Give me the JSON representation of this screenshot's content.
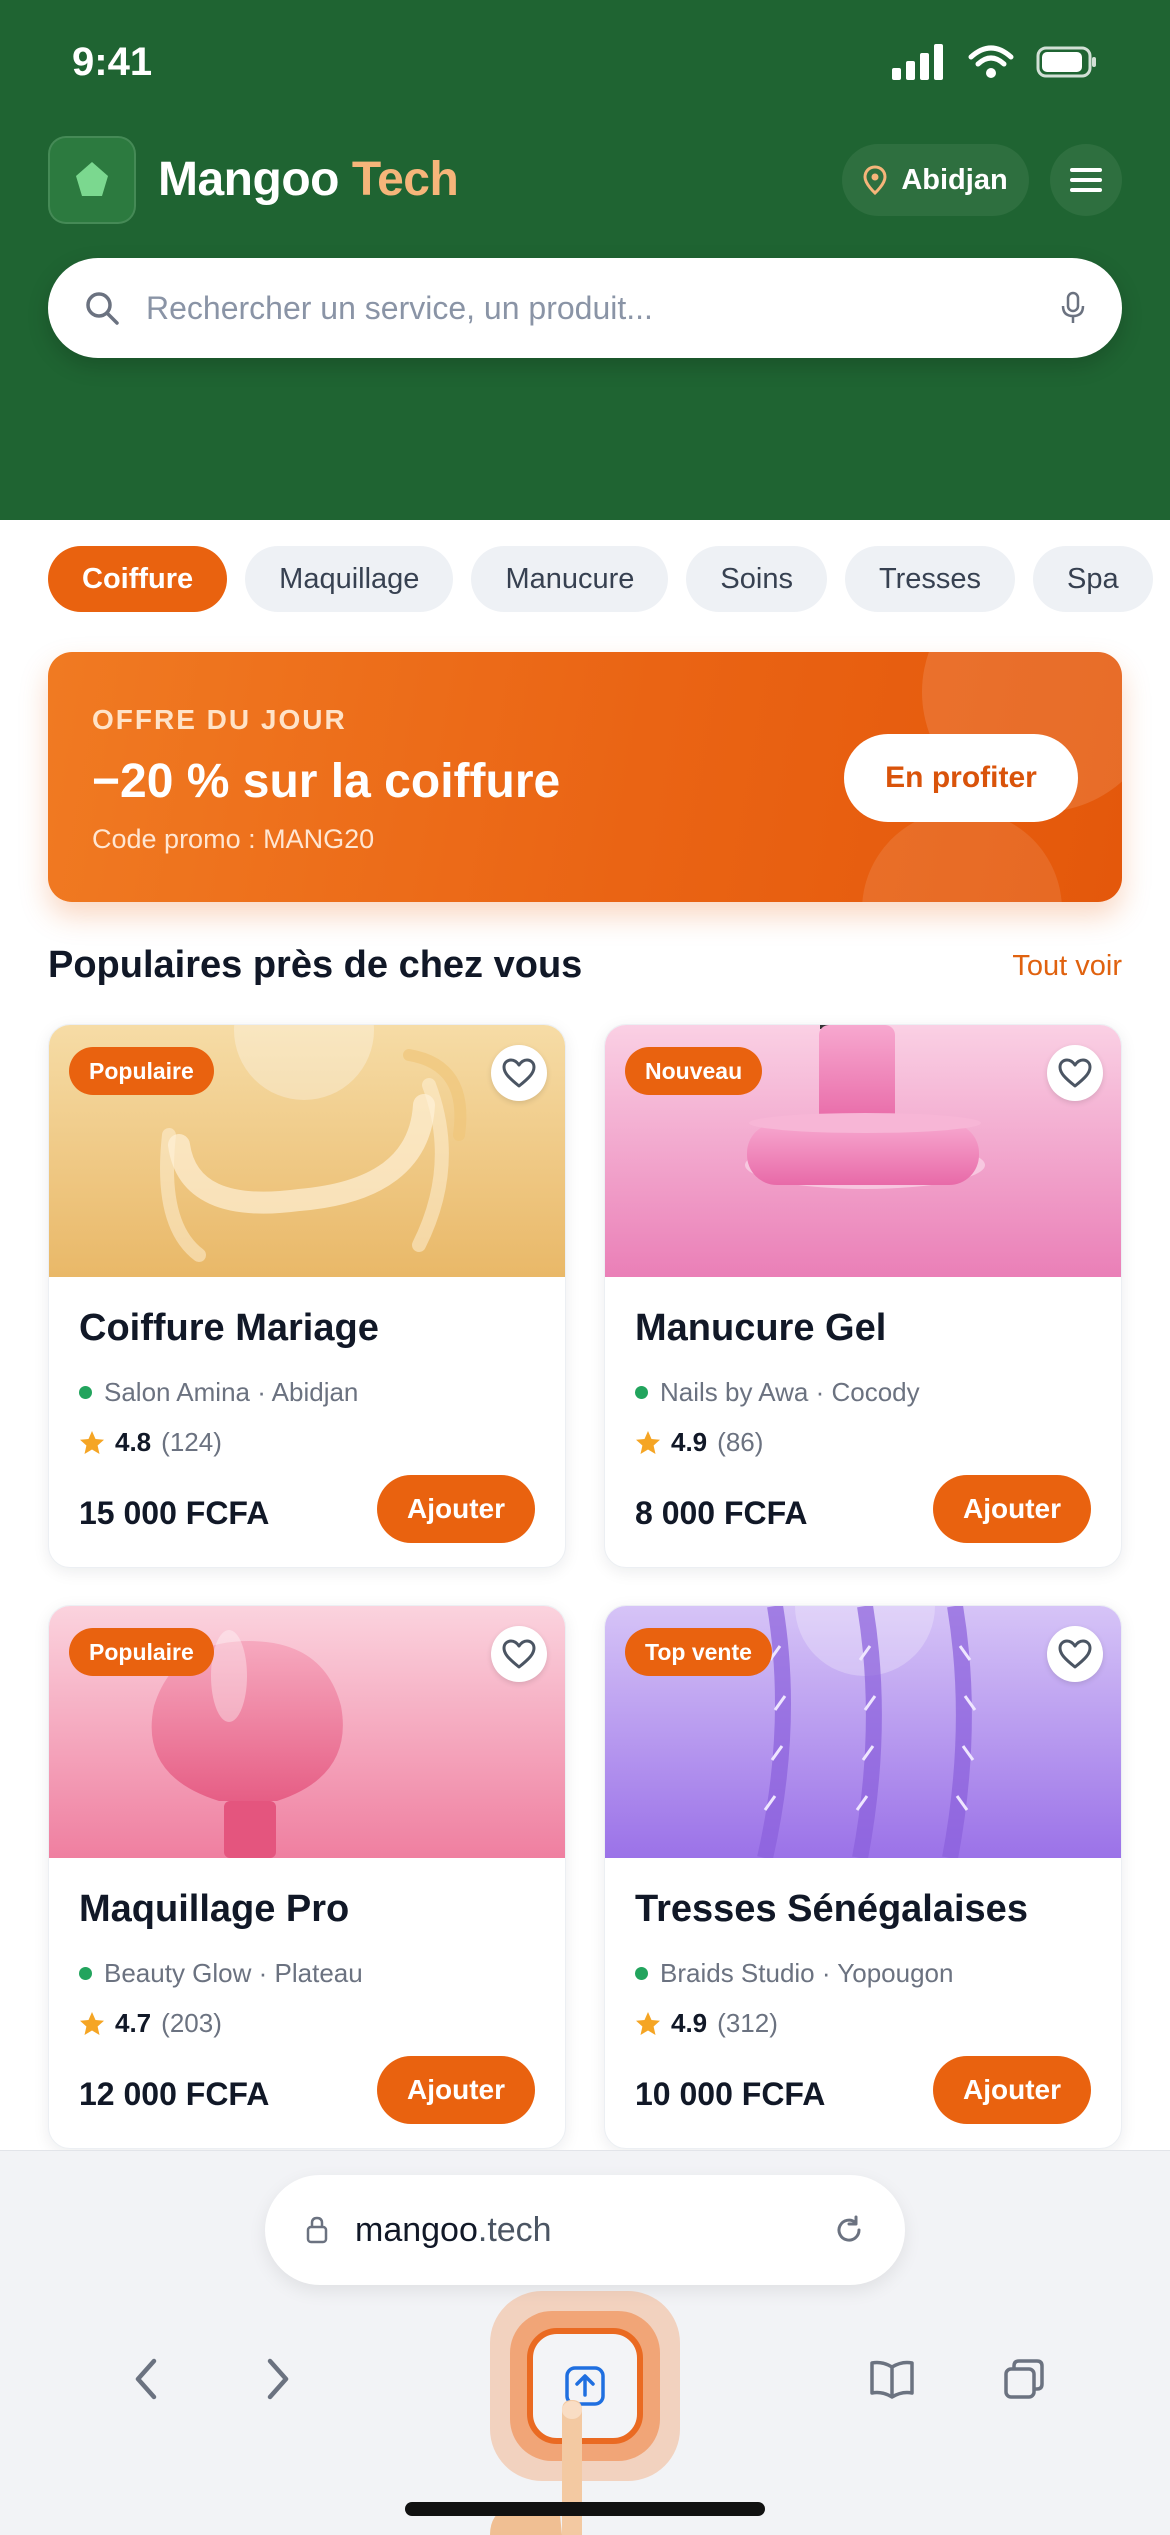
{
  "status_bar": {
    "time": "9:41"
  },
  "header": {
    "brand_main": "Mangoo",
    "brand_accent": "Tech",
    "location": "Abidjan"
  },
  "search": {
    "placeholder": "Rechercher un service, un produit..."
  },
  "categories": [
    {
      "label": "Coiffure",
      "active": true
    },
    {
      "label": "Maquillage",
      "active": false
    },
    {
      "label": "Manucure",
      "active": false
    },
    {
      "label": "Soins",
      "active": false
    },
    {
      "label": "Tresses",
      "active": false
    },
    {
      "label": "Spa",
      "active": false
    }
  ],
  "promo": {
    "kicker": "OFFRE DU JOUR",
    "title": "−20 % sur la coiffure",
    "code": "Code promo : MANG20",
    "button": "En profiter"
  },
  "section": {
    "title": "Populaires près de chez vous",
    "see_all": "Tout voir"
  },
  "products": [
    {
      "badge": "Populaire",
      "title": "Coiffure Mariage",
      "vendor": "Salon Amina · Abidjan",
      "rating": "4.8",
      "reviews": "(124)",
      "price": "15 000 FCFA",
      "button": "Ajouter"
    },
    {
      "badge": "Nouveau",
      "title": "Manucure Gel",
      "vendor": "Nails by Awa · Cocody",
      "rating": "4.9",
      "reviews": "(86)",
      "price": "8 000 FCFA",
      "button": "Ajouter"
    },
    {
      "badge": "Populaire",
      "title": "Maquillage Pro",
      "vendor": "Beauty Glow · Plateau",
      "rating": "4.7",
      "reviews": "(203)",
      "price": "12 000 FCFA",
      "button": "Ajouter"
    },
    {
      "badge": "Top vente",
      "title": "Tresses Sénégalaises",
      "vendor": "Braids Studio · Yopougon",
      "rating": "4.9",
      "reviews": "(312)",
      "price": "10 000 FCFA",
      "button": "Ajouter"
    }
  ],
  "browser": {
    "domain": "mangoo",
    "tld": ".tech"
  },
  "colors": {
    "header_green": "#1f6432",
    "accent_orange": "#e9620f",
    "brand_accent": "#f6b57a"
  }
}
